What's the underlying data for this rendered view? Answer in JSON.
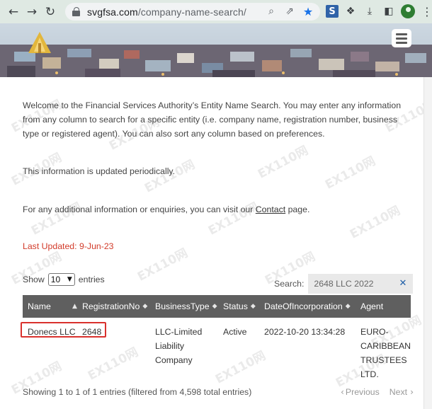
{
  "browser": {
    "url_domain": "svgfsa.com",
    "url_path": "/company-name-search/",
    "icons": [
      "back-arrow",
      "forward-arrow",
      "reload",
      "lock",
      "zoom",
      "share",
      "bookmark-star",
      "extension-s",
      "puzzle",
      "download",
      "side-panel",
      "profile",
      "more-vert"
    ]
  },
  "site": {
    "menu_icon": "hamburger-menu"
  },
  "intro": {
    "welcome": "Welcome to the Financial Services Authority’s Entity Name Search. You may enter any information from any column to search for a specific entity (i.e. company name, registration number, business type or registered agent). You can also sort any column based on preferences.",
    "updated_note": "This information is updated periodically.",
    "contact_prefix": "For any additional information or enquiries, you can visit our ",
    "contact_link": "Contact",
    "contact_suffix": " page.",
    "last_updated": "Last Updated:  9-Jun-23"
  },
  "controls": {
    "show_label": "Show",
    "entries_value": "10",
    "entries_label": "entries",
    "search_label": "Search:",
    "search_value": "2648 LLC 2022",
    "clear_icon": "close-x"
  },
  "table": {
    "columns": [
      "Name",
      "RegistrationNo",
      "BusinessType",
      "Status",
      "DateOfIncorporation",
      "Agent"
    ],
    "rows": [
      {
        "name": "Donecs LLC",
        "registration_no": "2648",
        "business_type": [
          "LLC-Limited",
          "Liability",
          "Company"
        ],
        "status": "Active",
        "date": "2022-10-20 13:34:28",
        "agent": [
          "EURO-",
          "CARIBBEAN",
          "TRUSTEES",
          "LTD."
        ]
      }
    ]
  },
  "footer": {
    "info": "Showing 1 to 1 of 1 entries (filtered from 4,598 total entries)",
    "previous": "Previous",
    "next": "Next"
  },
  "colors": {
    "accent_red": "#d23b2a",
    "header_gray": "#5f5f5f",
    "highlight_box": "#d9312d",
    "chrome_bg": "#dfe9e3"
  }
}
